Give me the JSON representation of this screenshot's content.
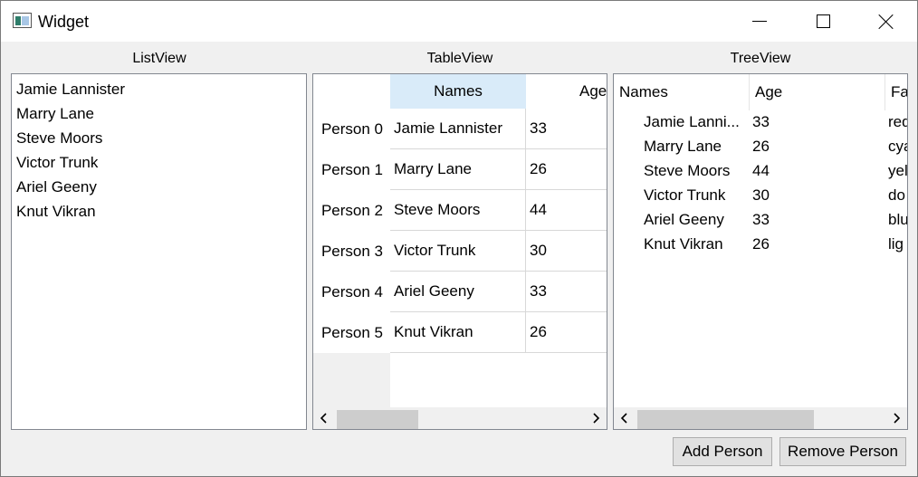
{
  "window": {
    "title": "Widget"
  },
  "captions": {
    "list": "ListView",
    "table": "TableView",
    "tree": "TreeView"
  },
  "list_items": [
    "Jamie Lannister",
    "Marry Lane",
    "Steve Moors",
    "Victor Trunk",
    "Ariel Geeny",
    "Knut Vikran"
  ],
  "table": {
    "headers": [
      "Names",
      "Age"
    ],
    "row_headers": [
      "Person 0",
      "Person 1",
      "Person 2",
      "Person 3",
      "Person 4",
      "Person 5"
    ],
    "rows": [
      [
        "Jamie Lannister",
        "33"
      ],
      [
        "Marry Lane",
        "26"
      ],
      [
        "Steve Moors",
        "44"
      ],
      [
        "Victor Trunk",
        "30"
      ],
      [
        "Ariel Geeny",
        "33"
      ],
      [
        "Knut Vikran",
        "26"
      ]
    ]
  },
  "tree": {
    "headers": [
      "Names",
      "Age",
      "Fa"
    ],
    "rows": [
      [
        "Jamie Lanni...",
        "33",
        "red"
      ],
      [
        "Marry Lane",
        "26",
        "cya"
      ],
      [
        "Steve Moors",
        "44",
        "yel"
      ],
      [
        "Victor Trunk",
        "30",
        "do"
      ],
      [
        "Ariel Geeny",
        "33",
        "blu"
      ],
      [
        "Knut Vikran",
        "26",
        "lig"
      ]
    ]
  },
  "buttons": {
    "add": "Add Person",
    "remove": "Remove Person"
  },
  "colors": {
    "selected_header": "#d9ebf9",
    "scroll_thumb": "#cdcdcd"
  },
  "icons": {
    "app": "qt-widget-icon",
    "minimize": "minimize-icon",
    "maximize": "maximize-icon",
    "close": "close-icon",
    "scroll_left": "chevron-left-icon",
    "scroll_right": "chevron-right-icon"
  }
}
